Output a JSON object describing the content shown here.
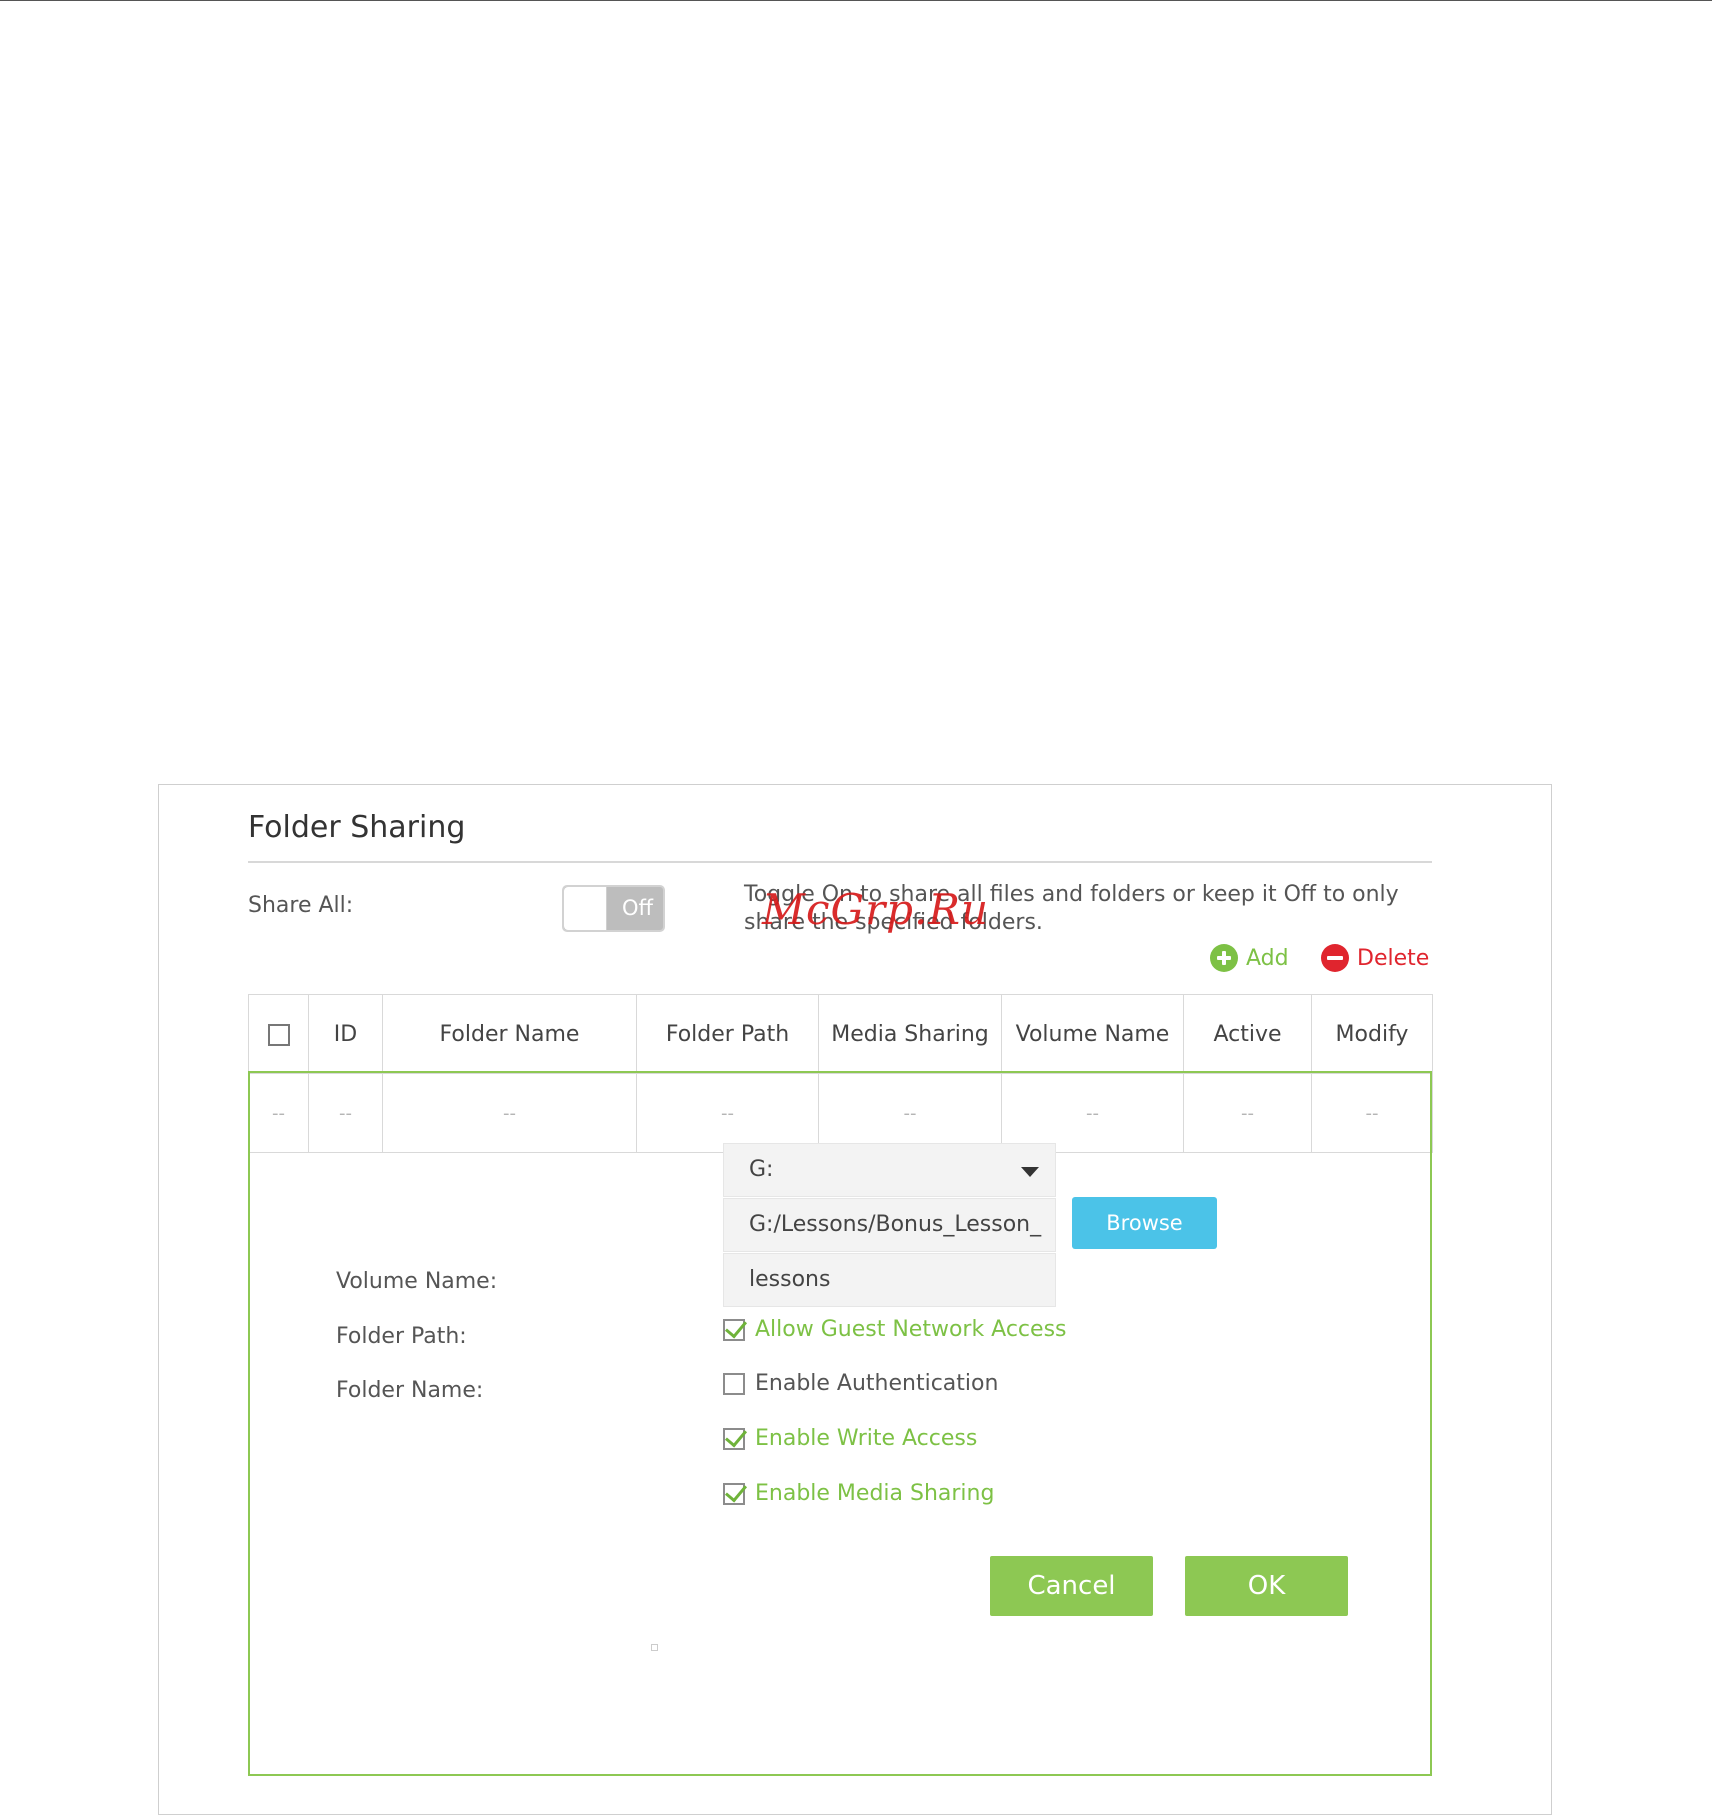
{
  "window": {
    "title": "Folder Sharing"
  },
  "share_all": {
    "label": "Share All:",
    "toggle_state": "Off",
    "hint": "Toggle On to share all files and folders or keep it Off to only share the specified folders."
  },
  "watermark": "McGrp.Ru",
  "toolbar": {
    "add_label": "Add",
    "delete_label": "Delete"
  },
  "table": {
    "columns": [
      "ID",
      "Folder Name",
      "Folder Path",
      "Media Sharing",
      "Volume Name",
      "Active",
      "Modify"
    ],
    "rows": [
      [
        "--",
        "--",
        "--",
        "--",
        "--",
        "--",
        "--",
        "--"
      ]
    ]
  },
  "form": {
    "volume_name": {
      "label": "Volume Name:",
      "value": "G:"
    },
    "folder_path": {
      "label": "Folder Path:",
      "value": "G:/Lessons/Bonus_Lesson_"
    },
    "folder_name": {
      "label": "Folder Name:",
      "value": "lessons"
    },
    "browse_label": "Browse",
    "options": [
      {
        "label": "Allow Guest Network Access",
        "checked": true
      },
      {
        "label": "Enable Authentication",
        "checked": false
      },
      {
        "label": "Enable Write Access",
        "checked": true
      },
      {
        "label": "Enable Media Sharing",
        "checked": true
      }
    ],
    "cancel_label": "Cancel",
    "ok_label": "OK"
  },
  "colors": {
    "accent_green": "#8dc853",
    "delete_red": "#e0252e",
    "browse_blue": "#4bc3e8"
  }
}
